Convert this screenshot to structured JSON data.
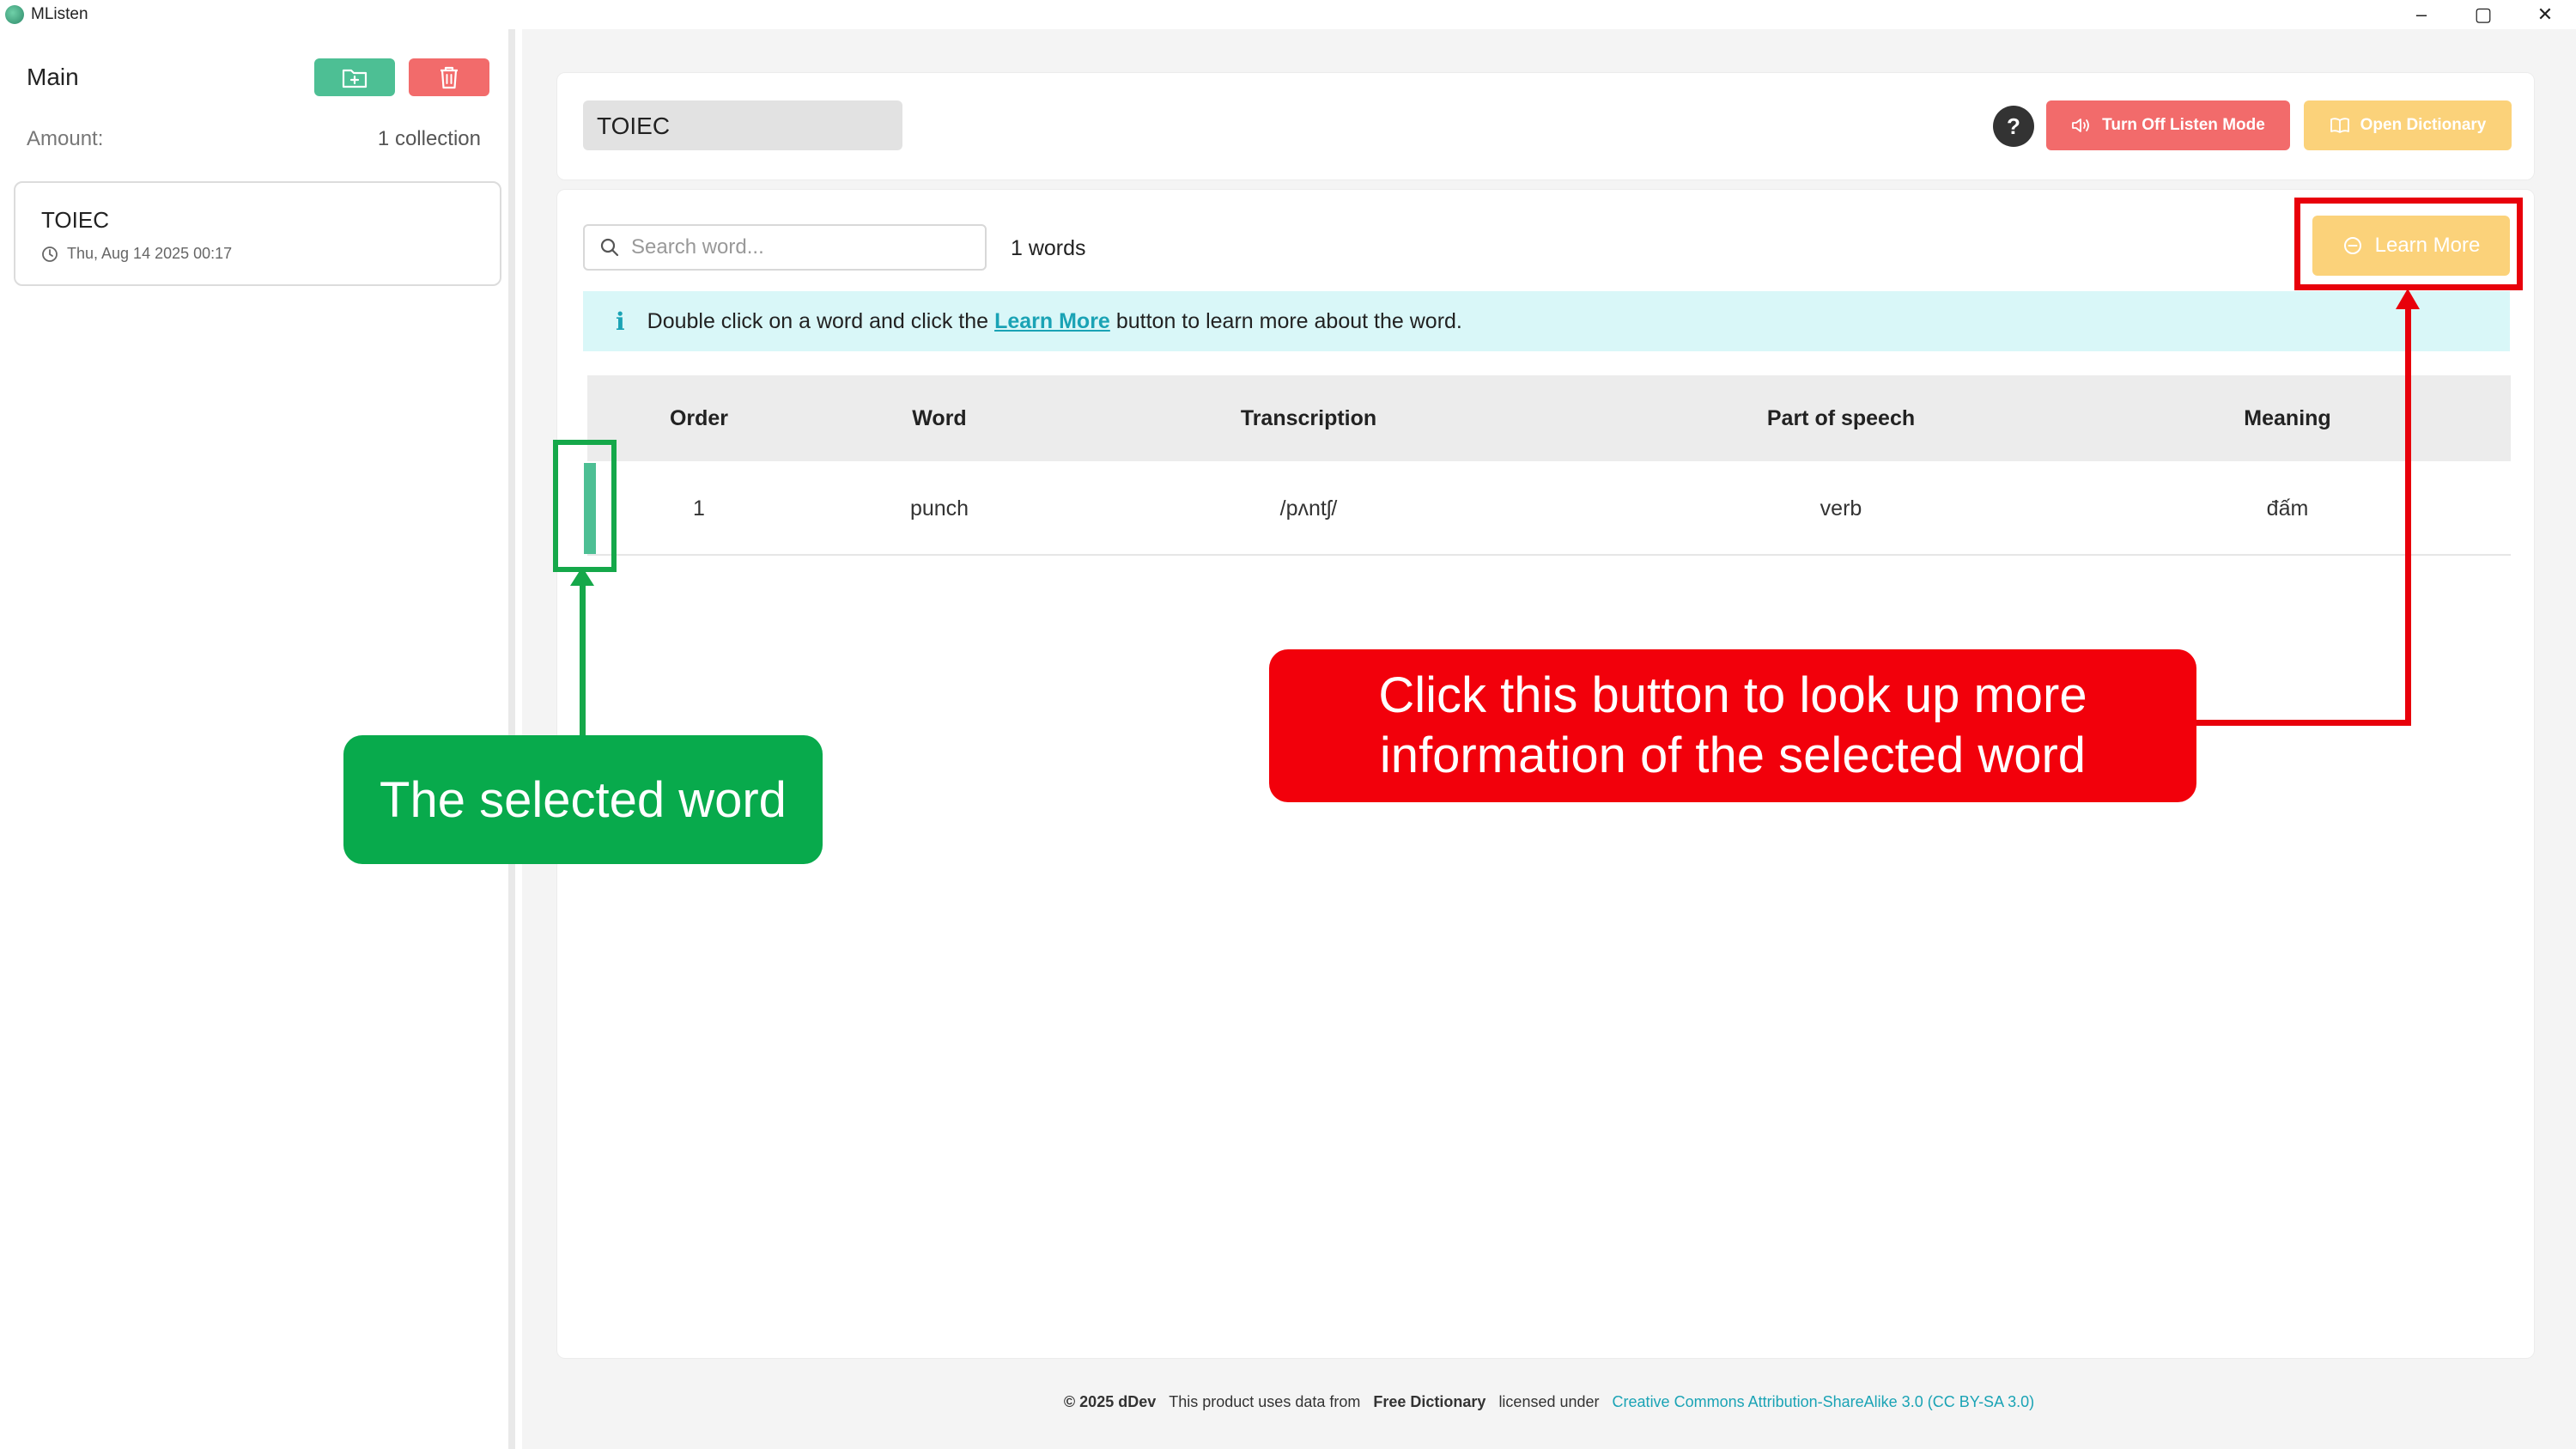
{
  "window": {
    "title": "MListen",
    "controls": [
      "–",
      "▢",
      "✕"
    ]
  },
  "sidebar": {
    "heading": "Main",
    "amount_label": "Amount:",
    "amount_value": "1 collection",
    "collections": [
      {
        "name": "TOIEC",
        "date": "Thu, Aug 14 2025 00:17"
      }
    ]
  },
  "toolbar": {
    "collection_title": "TOIEC",
    "help_label": "?",
    "listen_mode_label": "Turn Off Listen Mode",
    "dictionary_label": "Open Dictionary"
  },
  "content": {
    "search_placeholder": "Search word...",
    "word_count": "1 words",
    "learn_more_label": "Learn More",
    "info": {
      "before": "Double click on a word and click the",
      "link": "Learn More",
      "after": "button to learn more about the word."
    },
    "table": {
      "headers": [
        "Order",
        "Word",
        "Transcription",
        "Part of speech",
        "Meaning"
      ],
      "rows": [
        {
          "order": "1",
          "word": "punch",
          "transcription": "/pʌntʃ/",
          "pos": "verb",
          "meaning": "đấm"
        }
      ]
    }
  },
  "footer": {
    "copyright": "© 2025 dDev",
    "uses": "This product uses data from",
    "source": "Free Dictionary",
    "licensed": "licensed under",
    "license": "Creative Commons Attribution-ShareAlike 3.0 (CC BY-SA 3.0)"
  },
  "annotations": {
    "selected_word": "The selected word",
    "learn_more_hint_line1": "Click this button to look up more",
    "learn_more_hint_line2": "information of the selected word"
  },
  "colors": {
    "green": "#4dbf94",
    "red": "#f26b6b",
    "yellow": "#fbd27a",
    "teal": "#1aa3b5",
    "annotation_green": "#08aa4c",
    "annotation_red": "#f2000b"
  }
}
